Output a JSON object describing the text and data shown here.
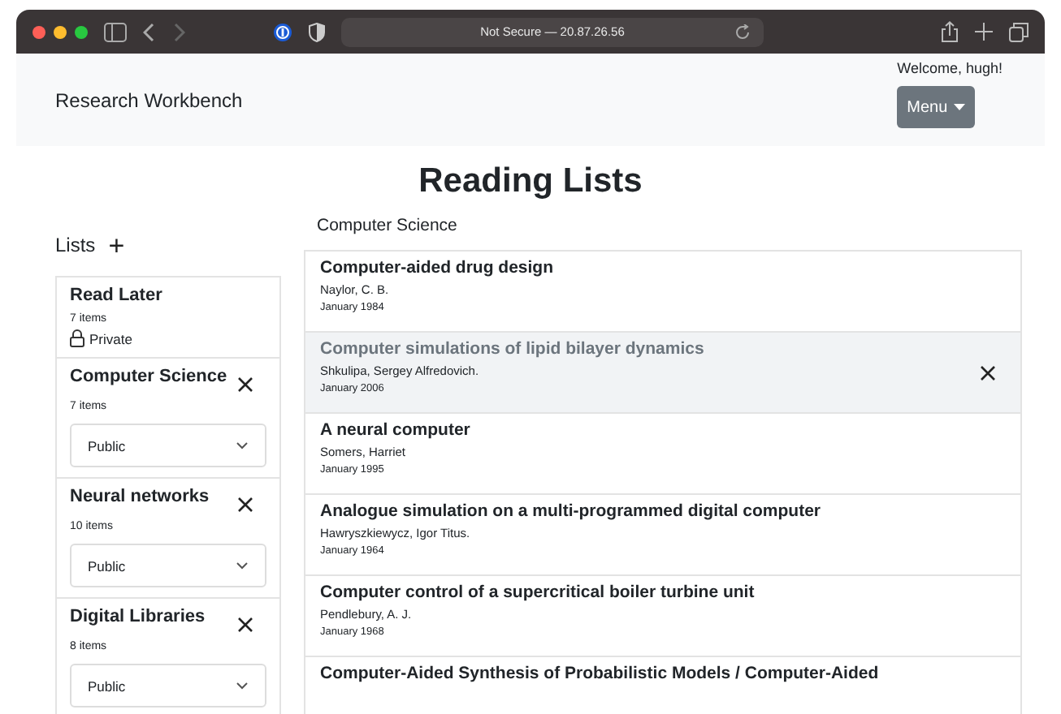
{
  "browser": {
    "address": "Not Secure — 20.87.26.56"
  },
  "navbar": {
    "brand": "Research Workbench",
    "welcome": "Welcome, hugh!",
    "menu_button": "Menu"
  },
  "page_title": "Reading Lists",
  "sidebar": {
    "heading": "Lists",
    "add_symbol": "+",
    "lists": [
      {
        "name": "Read Later",
        "count": "7 items",
        "kind": "fixed",
        "visibility": "Private"
      },
      {
        "name": "Computer Science",
        "count": "7 items",
        "kind": "editable",
        "visibility": "Public"
      },
      {
        "name": "Neural networks",
        "count": "10 items",
        "kind": "editable",
        "visibility": "Public"
      },
      {
        "name": "Digital Libraries",
        "count": "8 items",
        "kind": "editable",
        "visibility": "Public"
      }
    ]
  },
  "main": {
    "heading": "Computer Science",
    "items": [
      {
        "title": "Computer-aided drug design",
        "author": "Naylor, C. B.",
        "date": "January 1984",
        "hovered": false
      },
      {
        "title": "Computer simulations of lipid bilayer dynamics",
        "author": "Shkulipa, Sergey Alfredovich.",
        "date": "January 2006",
        "hovered": true
      },
      {
        "title": "A neural computer",
        "author": "Somers, Harriet",
        "date": "January 1995",
        "hovered": false
      },
      {
        "title": "Analogue simulation on a multi-programmed digital computer",
        "author": "Hawryszkiewycz, Igor Titus.",
        "date": "January 1964",
        "hovered": false
      },
      {
        "title": "Computer control of a supercritical boiler turbine unit",
        "author": "Pendlebury, A. J.",
        "date": "January 1968",
        "hovered": false
      },
      {
        "title": "Computer-Aided Synthesis of Probabilistic Models / Computer-Aided",
        "hovered": false
      }
    ]
  }
}
